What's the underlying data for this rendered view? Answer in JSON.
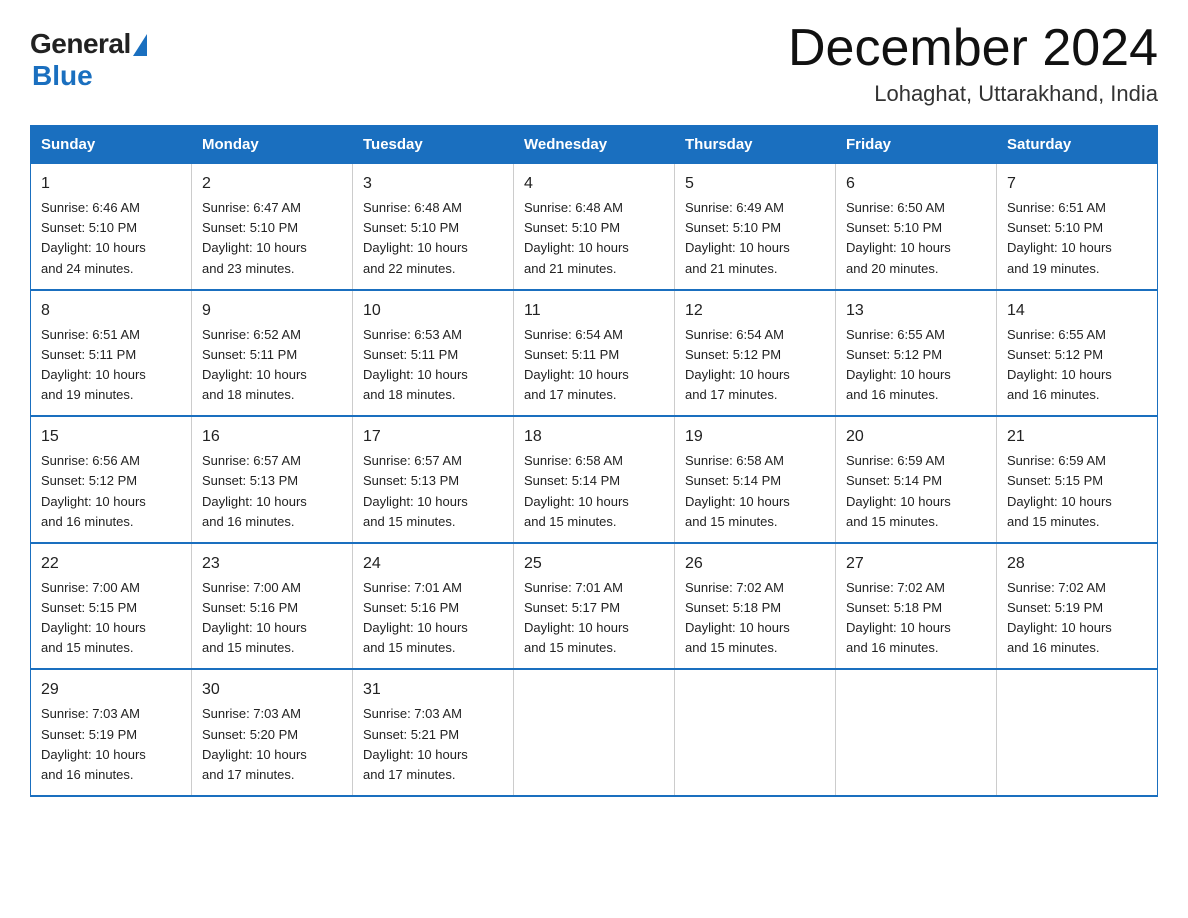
{
  "header": {
    "logo_general": "General",
    "logo_blue": "Blue",
    "title": "December 2024",
    "subtitle": "Lohaghat, Uttarakhand, India"
  },
  "days_of_week": [
    "Sunday",
    "Monday",
    "Tuesday",
    "Wednesday",
    "Thursday",
    "Friday",
    "Saturday"
  ],
  "weeks": [
    [
      {
        "day": "1",
        "sunrise": "6:46 AM",
        "sunset": "5:10 PM",
        "daylight": "10 hours and 24 minutes."
      },
      {
        "day": "2",
        "sunrise": "6:47 AM",
        "sunset": "5:10 PM",
        "daylight": "10 hours and 23 minutes."
      },
      {
        "day": "3",
        "sunrise": "6:48 AM",
        "sunset": "5:10 PM",
        "daylight": "10 hours and 22 minutes."
      },
      {
        "day": "4",
        "sunrise": "6:48 AM",
        "sunset": "5:10 PM",
        "daylight": "10 hours and 21 minutes."
      },
      {
        "day": "5",
        "sunrise": "6:49 AM",
        "sunset": "5:10 PM",
        "daylight": "10 hours and 21 minutes."
      },
      {
        "day": "6",
        "sunrise": "6:50 AM",
        "sunset": "5:10 PM",
        "daylight": "10 hours and 20 minutes."
      },
      {
        "day": "7",
        "sunrise": "6:51 AM",
        "sunset": "5:10 PM",
        "daylight": "10 hours and 19 minutes."
      }
    ],
    [
      {
        "day": "8",
        "sunrise": "6:51 AM",
        "sunset": "5:11 PM",
        "daylight": "10 hours and 19 minutes."
      },
      {
        "day": "9",
        "sunrise": "6:52 AM",
        "sunset": "5:11 PM",
        "daylight": "10 hours and 18 minutes."
      },
      {
        "day": "10",
        "sunrise": "6:53 AM",
        "sunset": "5:11 PM",
        "daylight": "10 hours and 18 minutes."
      },
      {
        "day": "11",
        "sunrise": "6:54 AM",
        "sunset": "5:11 PM",
        "daylight": "10 hours and 17 minutes."
      },
      {
        "day": "12",
        "sunrise": "6:54 AM",
        "sunset": "5:12 PM",
        "daylight": "10 hours and 17 minutes."
      },
      {
        "day": "13",
        "sunrise": "6:55 AM",
        "sunset": "5:12 PM",
        "daylight": "10 hours and 16 minutes."
      },
      {
        "day": "14",
        "sunrise": "6:55 AM",
        "sunset": "5:12 PM",
        "daylight": "10 hours and 16 minutes."
      }
    ],
    [
      {
        "day": "15",
        "sunrise": "6:56 AM",
        "sunset": "5:12 PM",
        "daylight": "10 hours and 16 minutes."
      },
      {
        "day": "16",
        "sunrise": "6:57 AM",
        "sunset": "5:13 PM",
        "daylight": "10 hours and 16 minutes."
      },
      {
        "day": "17",
        "sunrise": "6:57 AM",
        "sunset": "5:13 PM",
        "daylight": "10 hours and 15 minutes."
      },
      {
        "day": "18",
        "sunrise": "6:58 AM",
        "sunset": "5:14 PM",
        "daylight": "10 hours and 15 minutes."
      },
      {
        "day": "19",
        "sunrise": "6:58 AM",
        "sunset": "5:14 PM",
        "daylight": "10 hours and 15 minutes."
      },
      {
        "day": "20",
        "sunrise": "6:59 AM",
        "sunset": "5:14 PM",
        "daylight": "10 hours and 15 minutes."
      },
      {
        "day": "21",
        "sunrise": "6:59 AM",
        "sunset": "5:15 PM",
        "daylight": "10 hours and 15 minutes."
      }
    ],
    [
      {
        "day": "22",
        "sunrise": "7:00 AM",
        "sunset": "5:15 PM",
        "daylight": "10 hours and 15 minutes."
      },
      {
        "day": "23",
        "sunrise": "7:00 AM",
        "sunset": "5:16 PM",
        "daylight": "10 hours and 15 minutes."
      },
      {
        "day": "24",
        "sunrise": "7:01 AM",
        "sunset": "5:16 PM",
        "daylight": "10 hours and 15 minutes."
      },
      {
        "day": "25",
        "sunrise": "7:01 AM",
        "sunset": "5:17 PM",
        "daylight": "10 hours and 15 minutes."
      },
      {
        "day": "26",
        "sunrise": "7:02 AM",
        "sunset": "5:18 PM",
        "daylight": "10 hours and 15 minutes."
      },
      {
        "day": "27",
        "sunrise": "7:02 AM",
        "sunset": "5:18 PM",
        "daylight": "10 hours and 16 minutes."
      },
      {
        "day": "28",
        "sunrise": "7:02 AM",
        "sunset": "5:19 PM",
        "daylight": "10 hours and 16 minutes."
      }
    ],
    [
      {
        "day": "29",
        "sunrise": "7:03 AM",
        "sunset": "5:19 PM",
        "daylight": "10 hours and 16 minutes."
      },
      {
        "day": "30",
        "sunrise": "7:03 AM",
        "sunset": "5:20 PM",
        "daylight": "10 hours and 17 minutes."
      },
      {
        "day": "31",
        "sunrise": "7:03 AM",
        "sunset": "5:21 PM",
        "daylight": "10 hours and 17 minutes."
      },
      null,
      null,
      null,
      null
    ]
  ],
  "labels": {
    "sunrise_prefix": "Sunrise: ",
    "sunset_prefix": "Sunset: ",
    "daylight_prefix": "Daylight: "
  }
}
